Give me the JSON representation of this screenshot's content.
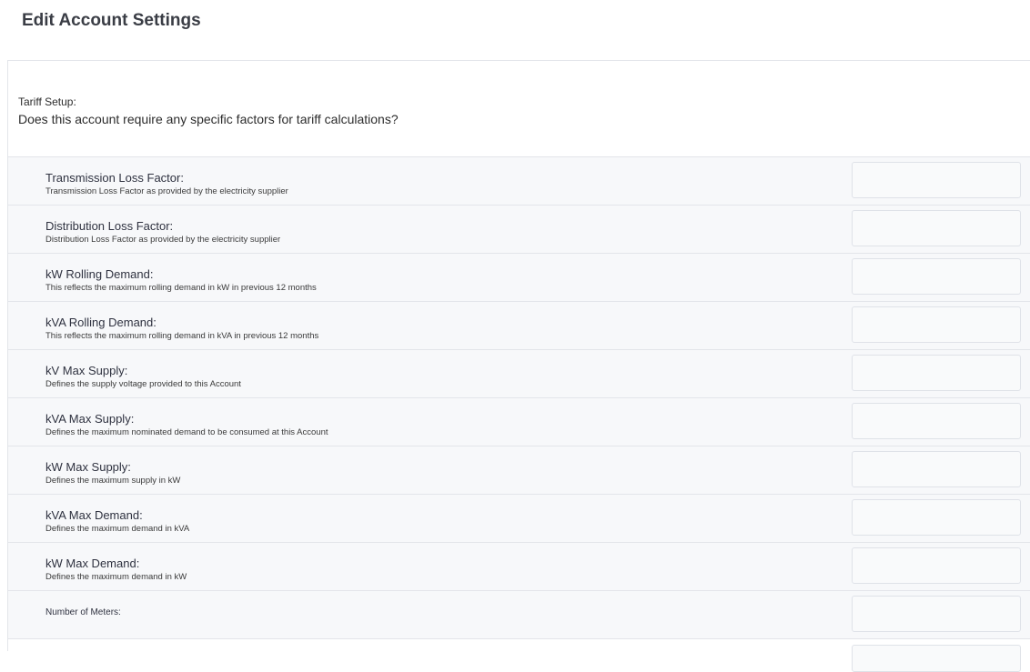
{
  "page": {
    "title": "Edit Account Settings"
  },
  "tariff_section": {
    "label": "Tariff Setup:",
    "question": "Does this account require any specific factors for tariff calculations?"
  },
  "fields": [
    {
      "label": "Transmission Loss Factor:",
      "description": "Transmission Loss Factor as provided by the electricity supplier",
      "value": ""
    },
    {
      "label": "Distribution Loss Factor:",
      "description": "Distribution Loss Factor as provided by the electricity supplier",
      "value": ""
    },
    {
      "label": "kW Rolling Demand:",
      "description": "This reflects the maximum rolling demand in kW in previous 12 months",
      "value": ""
    },
    {
      "label": "kVA Rolling Demand:",
      "description": "This reflects the maximum rolling demand in kVA in previous 12 months",
      "value": ""
    },
    {
      "label": "kV Max Supply:",
      "description": "Defines the supply voltage provided to this Account",
      "value": ""
    },
    {
      "label": "kVA Max Supply:",
      "description": "Defines the maximum nominated demand to be consumed at this Account",
      "value": ""
    },
    {
      "label": "kW Max Supply:",
      "description": "Defines the maximum supply in kW",
      "value": ""
    },
    {
      "label": "kVA Max Demand:",
      "description": "Defines the maximum demand in kVA",
      "value": ""
    },
    {
      "label": "kW Max Demand:",
      "description": "Defines the maximum demand in kW",
      "value": ""
    }
  ],
  "meters_field": {
    "label": "Number of Meters:",
    "value": ""
  },
  "colors": {
    "row_background": "#f7f8fa",
    "border": "#e3e5ea",
    "title_text": "#3a3d45"
  }
}
